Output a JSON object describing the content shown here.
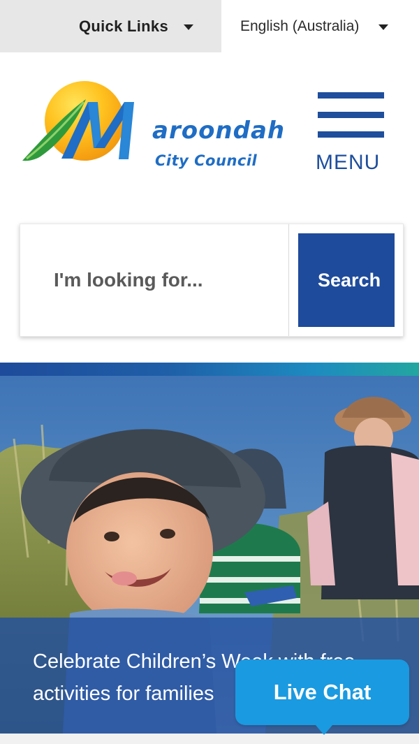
{
  "topbar": {
    "quick_links": "Quick Links",
    "language": "English (Australia)"
  },
  "header": {
    "logo_word": "aroondah",
    "logo_sub": "City Council",
    "menu_label": "MENU"
  },
  "search": {
    "placeholder": "I'm looking for...",
    "button_label": "Search"
  },
  "hero": {
    "caption": "Celebrate Children’s Week with free activities for families"
  },
  "live_chat": {
    "label": "Live Chat"
  },
  "colors": {
    "brand_blue": "#1e4b9b",
    "chat_blue": "#1a9ae0",
    "logo_blue": "#1f6dc4",
    "sun_orange": "#f6a012"
  }
}
